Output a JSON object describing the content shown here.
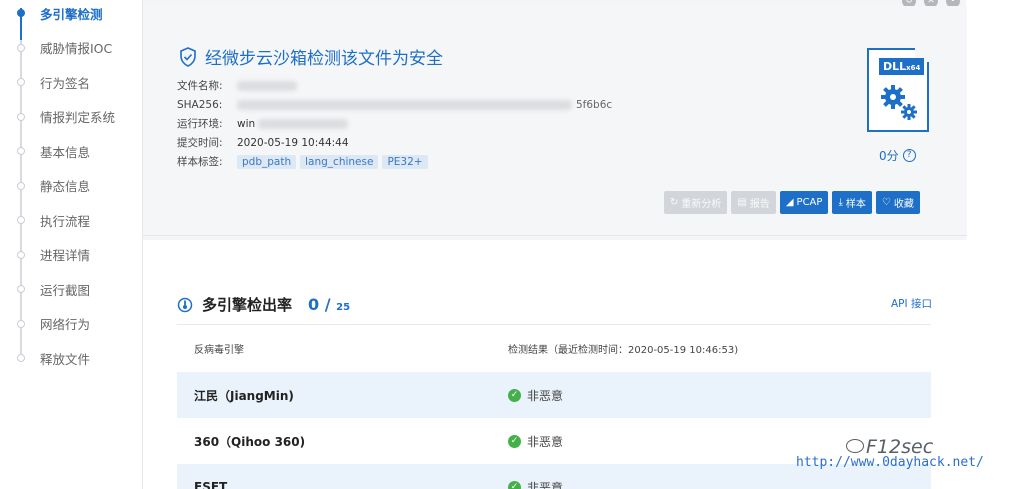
{
  "nav": {
    "items": [
      {
        "label": "多引擎检测",
        "active": true
      },
      {
        "label": "威胁情报IOC",
        "active": false
      },
      {
        "label": "行为签名",
        "active": false
      },
      {
        "label": "情报判定系统",
        "active": false
      },
      {
        "label": "基本信息",
        "active": false
      },
      {
        "label": "静态信息",
        "active": false
      },
      {
        "label": "执行流程",
        "active": false
      },
      {
        "label": "进程详情",
        "active": false
      },
      {
        "label": "运行截图",
        "active": false
      },
      {
        "label": "网络行为",
        "active": false
      },
      {
        "label": "释放文件",
        "active": false
      }
    ]
  },
  "summary": {
    "verdict": "经微步云沙箱检测该文件为安全",
    "meta": {
      "filename_label": "文件名称:",
      "sha256_label": "SHA256:",
      "sha256_suffix": "5f6b6c",
      "env_label": "运行环境:",
      "env_value": "win",
      "submit_label": "提交时间:",
      "submit_value": "2020-05-19 10:44:44",
      "tags_label": "样本标签:",
      "tags": [
        "pdb_path",
        "lang_chinese",
        "PE32+"
      ]
    },
    "file_badge": "DLL",
    "file_arch": "x64",
    "score": "0分",
    "help": "?",
    "actions": [
      {
        "label": "重新分析",
        "icon": "↻",
        "disabled": true
      },
      {
        "label": "报告",
        "icon": "▤",
        "disabled": true
      },
      {
        "label": "PCAP",
        "icon": "◢",
        "disabled": false
      },
      {
        "label": "样本",
        "icon": "⤓",
        "disabled": false
      },
      {
        "label": "收藏",
        "icon": "♡",
        "disabled": false
      }
    ]
  },
  "engines": {
    "title": "多引擎检出率",
    "detected": "0",
    "separator": " / ",
    "total": "25",
    "api_link": "API 接口",
    "col_engine": "反病毒引擎",
    "col_result": "检测结果（最近检测时间：2020-05-19 10:46:53)",
    "rows": [
      {
        "engine": "江民（JiangMin)",
        "result": "非恶意"
      },
      {
        "engine": "360（Qihoo 360)",
        "result": "非恶意"
      },
      {
        "engine": "ESET",
        "result": "非恶意"
      }
    ]
  },
  "watermark": {
    "logo": "F12sec",
    "url": "http://www.0dayhack.net/"
  },
  "colors": {
    "accent": "#1d6fc8",
    "ok": "#43b049",
    "row_stripe": "#eaf2fb"
  }
}
